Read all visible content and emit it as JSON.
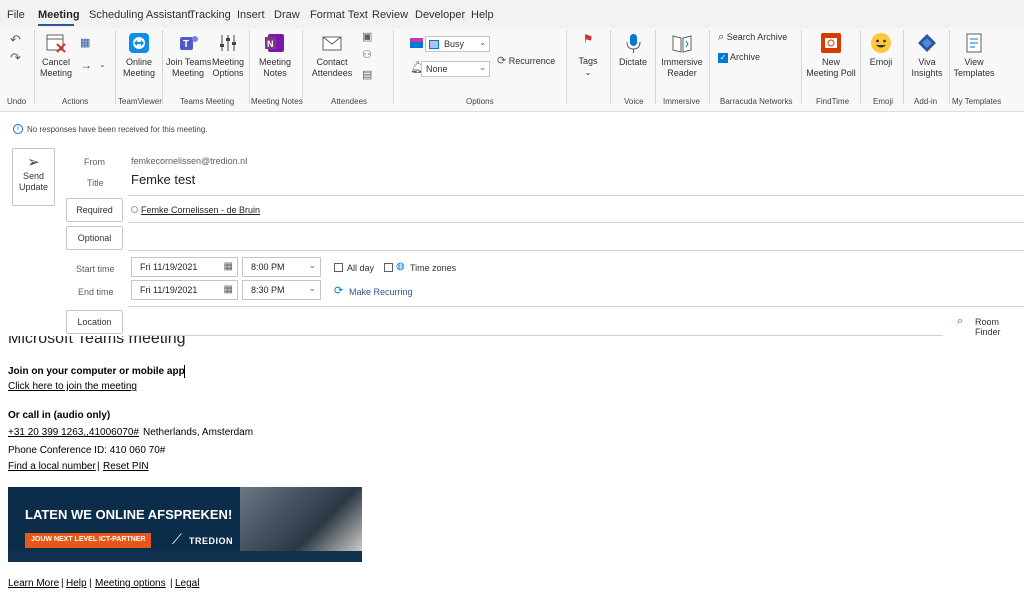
{
  "menu": [
    "File",
    "Meeting",
    "Scheduling Assistant",
    "Tracking",
    "Insert",
    "Draw",
    "Format Text",
    "Review",
    "Developer",
    "Help"
  ],
  "ribbon": {
    "undo_group": "Undo",
    "cancel_meeting": [
      "Cancel",
      "Meeting"
    ],
    "actions_group": "Actions",
    "online_meeting": [
      "Online",
      "Meeting"
    ],
    "teamviewer_group": "TeamViewer",
    "join_teams": [
      "Join Teams",
      "Meeting"
    ],
    "meeting_options": [
      "Meeting",
      "Options"
    ],
    "teams_group": "Teams Meeting",
    "meeting_notes": [
      "Meeting",
      "Notes"
    ],
    "notes_group": "Meeting Notes",
    "contact_attendees": [
      "Contact",
      "Attendees"
    ],
    "attendees_group": "Attendees",
    "show_as": "Busy",
    "reminder": "None",
    "recurrence": "Recurrence",
    "options_group": "Options",
    "tags": "Tags",
    "dictate": "Dictate",
    "voice_group": "Voice",
    "immersive_reader": [
      "Immersive",
      "Reader"
    ],
    "immersive_group": "Immersive",
    "search_archive": "Search Archive",
    "archive": "Archive",
    "barracuda_group": "Barracuda Networks",
    "new_meeting_poll": [
      "New",
      "Meeting Poll"
    ],
    "findtime_group": "FindTime",
    "emoji": "Emoji",
    "emoji_group": "Emoji",
    "viva_insights": [
      "Viva",
      "Insights"
    ],
    "addin_group": "Add-in",
    "view_templates": [
      "View",
      "Templates"
    ],
    "templates_group": "My Templates"
  },
  "form": {
    "info": "No responses have been received for this meeting.",
    "send_update": [
      "Send",
      "Update"
    ],
    "from_label": "From",
    "from_value": "femkecornelissen@tredion.nl",
    "title_label": "Title",
    "title_value": "Femke test",
    "required_label": "Required",
    "required_value": "Femke Cornelissen - de Bruin",
    "optional_label": "Optional",
    "start_label": "Start time",
    "start_date": "Fri 11/19/2021",
    "start_time": "8:00 PM",
    "all_day": "All day",
    "time_zones": "Time zones",
    "end_label": "End time",
    "end_date": "Fri 11/19/2021",
    "end_time": "8:30 PM",
    "make_recurring": "Make Recurring",
    "location_label": "Location",
    "room_finder": "Room Finder"
  },
  "body": {
    "teams_heading": "Microsoft Teams meeting",
    "join_heading": "Join on your computer or mobile app",
    "join_link": "Click here to join the meeting",
    "call_heading": "Or call in (audio only)",
    "phone_link": "+31 20 399 1263,,41006070#",
    "phone_location": "Netherlands, Amsterdam",
    "conference_id": "Phone Conference ID: 410 060 70#",
    "find_local": "Find a local number",
    "reset_pin": "Reset PIN",
    "banner_title": "LATEN WE ONLINE AFSPREKEN!",
    "banner_tag": "JOUW NEXT LEVEL ICT-PARTNER",
    "banner_brand": "TREDION",
    "learn_more": "Learn More",
    "help": "Help",
    "meeting_options": "Meeting options",
    "legal": "Legal",
    "sep": "|"
  }
}
